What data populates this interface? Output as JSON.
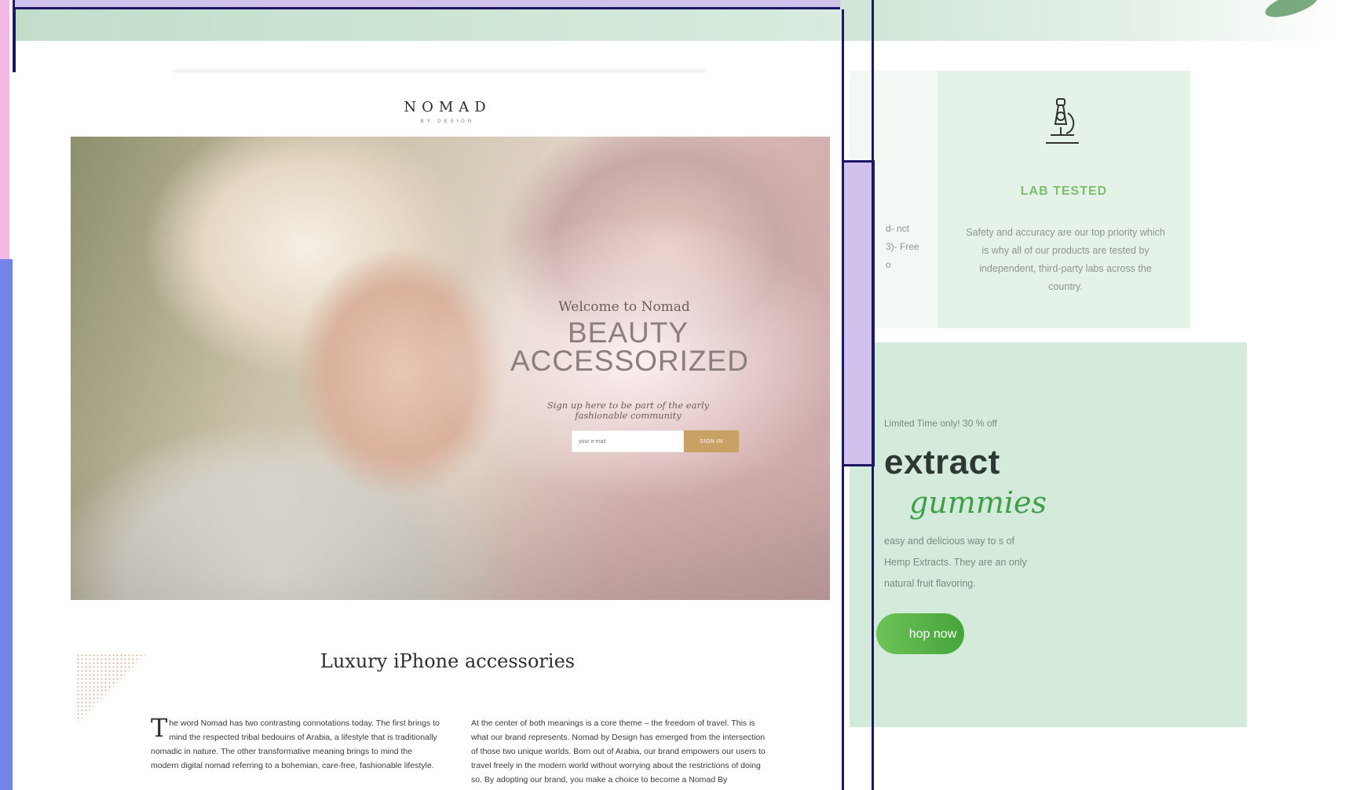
{
  "nomad": {
    "logo": "NOMAD",
    "logo_sub": "BY DESIGN",
    "hero": {
      "welcome": "Welcome to Nomad",
      "title_line1": "BEAUTY",
      "title_line2": "ACCESSORIZED",
      "subtitle_line1": "Sign up here to be part of the early",
      "subtitle_line2": "fashionable community",
      "email_placeholder": "your e-mail",
      "signin_label": "SIGN IN"
    },
    "section_title": "Luxury iPhone accessories",
    "col_left_dropcap": "T",
    "col_left_text": "he word Nomad has two contrasting connotations today. The first brings to mind the respected tribal bedouins of Arabia, a lifestyle that is traditionally nomadic in nature. The other transformative meaning brings to mind the modern digital nomad referring to a bohemian, care-free, fashionable lifestyle.",
    "col_right_text": "At the center of both meanings is a core theme – the freedom of travel. This is what our brand represents. Nomad by Design has emerged from the intersection of those two unique worlds. Born out of Arabia, our brand empowers our users to travel freely in the modern world without worrying about the restrictions of doing so. By adopting our brand, you make a choice to become a Nomad By"
  },
  "right_page": {
    "partial_text": "d- nct\n3)- Free\no",
    "lab_title": "LAB TESTED",
    "lab_text": "Safety and accuracy are our top priority which is why all of our products are tested by independent, third-party labs across the country.",
    "promo_small": "Limited Time only! 30 % off",
    "promo_big": "extract",
    "promo_script": "gummies",
    "promo_text": "easy and delicious way to s of Hemp Extracts. They are an only natural fruit flavoring.",
    "shop_label": "hop now"
  },
  "colors": {
    "gold_button": "#c8a167",
    "green_accent": "#45a53b",
    "navy_frame": "#1c1866",
    "lilac": "#cfc0ec"
  }
}
